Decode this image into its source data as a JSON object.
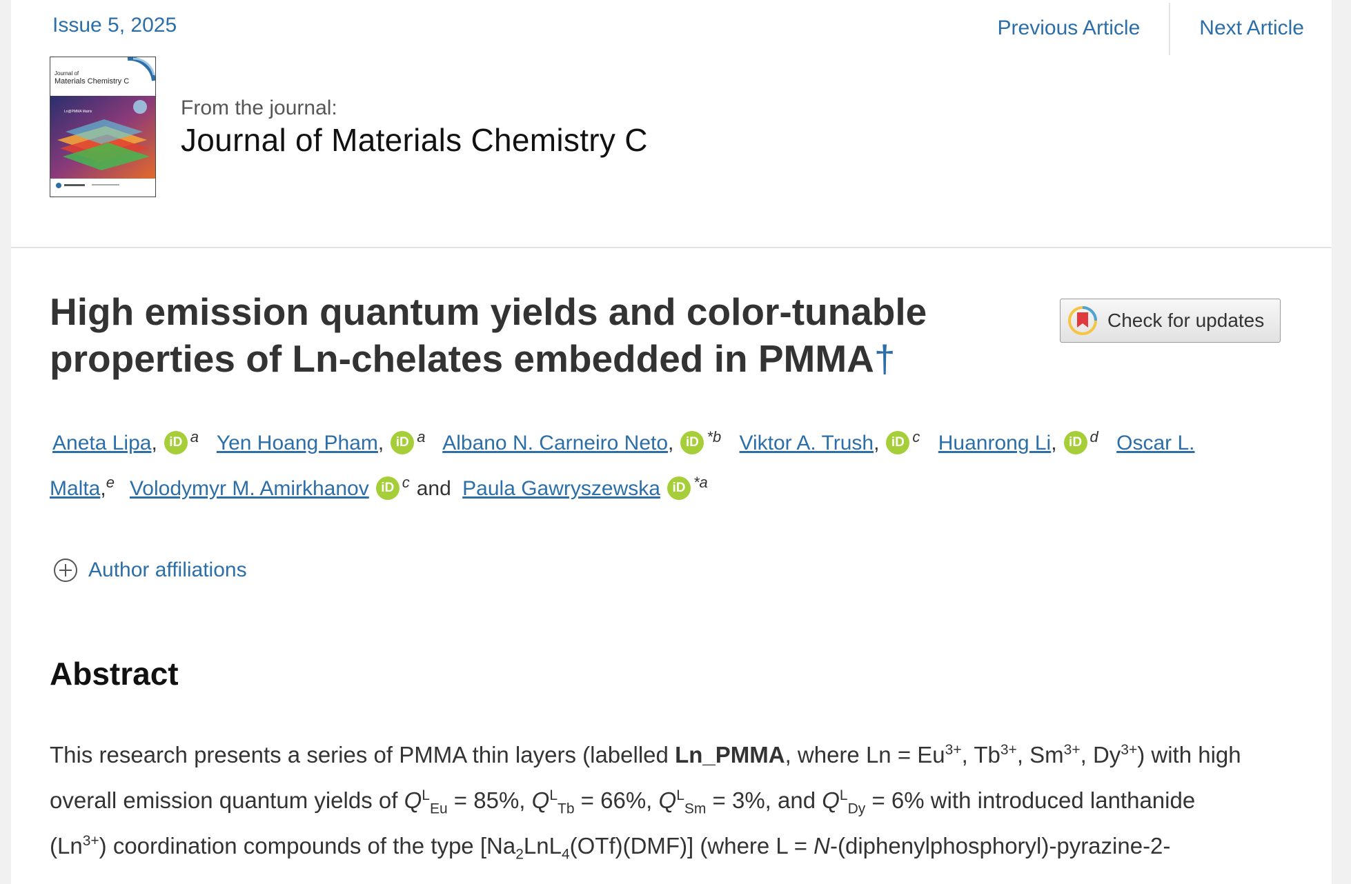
{
  "header": {
    "issue": "Issue 5, 2025",
    "prev": "Previous Article",
    "next": "Next Article",
    "from_label": "From the journal:",
    "journal": "Journal of Materials Chemistry C"
  },
  "cover": {
    "line1": "Journal of",
    "line2": "Materials Chemistry C",
    "art_label": "Ln@PMMA Matrix"
  },
  "article": {
    "title_line1": "High emission quantum yields and color-tunable",
    "title_line2": "properties of Ln-chelates embedded in PMMA",
    "dagger": "†",
    "check_updates": "Check for updates"
  },
  "authors": [
    {
      "name": "Aneta Lipa",
      "aff": "a"
    },
    {
      "name": "Yen Hoang Pham",
      "aff": "a"
    },
    {
      "name": "Albano N. Carneiro Neto",
      "aff": "*b"
    },
    {
      "name": "Viktor A. Trush",
      "aff": "c"
    },
    {
      "name": "Huanrong Li",
      "aff": "d"
    },
    {
      "name_part1": "Oscar L.",
      "name_part2": "Malta",
      "aff": "e"
    },
    {
      "name": "Volodymyr M. Amirkhanov",
      "aff": "c"
    },
    {
      "name": "Paula Gawryszewska",
      "aff": "*a"
    }
  ],
  "authors_and": "and",
  "orcid_badge": "iD",
  "affiliations_label": "Author affiliations",
  "abstract": {
    "heading": "Abstract",
    "l1_a": "This research presents a series of PMMA thin layers (labelled ",
    "l1_b": "Ln_PMMA",
    "l1_c": ", where Ln = Eu",
    "l1_sup1": "3+",
    "l1_d": ", Tb",
    "l1_sup2": "3+",
    "l1_e": ", Sm",
    "l1_sup3": "3+",
    "l1_f": ", Dy",
    "l1_sup4": "3+",
    "l1_g": ") with high",
    "l2_a": "overall emission quantum yields of ",
    "q": "Q",
    "qsup": "L",
    "l2_eu": "Eu",
    "l2_b": " = 85%, ",
    "l2_tb": "Tb",
    "l2_c": " = 66%, ",
    "l2_sm": "Sm",
    "l2_d": " = 3%, and ",
    "l2_dy": "Dy",
    "l2_e": " = 6% with introduced lanthanide",
    "l3_a": "(Ln",
    "l3_sup": "3+",
    "l3_b": ") coordination compounds of the type [Na",
    "l3_sub1": "2",
    "l3_c": "LnL",
    "l3_sub2": "4",
    "l3_d": "(OTf)(DMF)] (where L = ",
    "l3_n": "N",
    "l3_e": "-(diphenylphosphoryl)-pyrazine-2-"
  },
  "colors": {
    "link": "#2b6ea8",
    "orcid": "#a6ce39",
    "title": "#333333"
  }
}
